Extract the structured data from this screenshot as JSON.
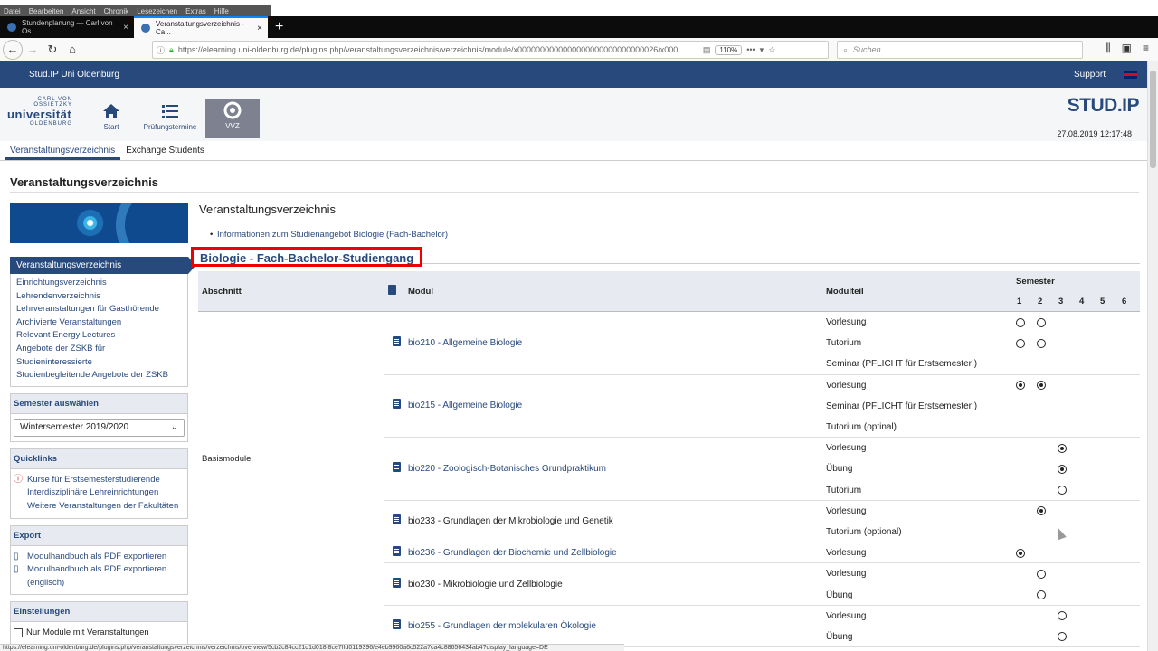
{
  "browser": {
    "menu": [
      "Datei",
      "Bearbeiten",
      "Ansicht",
      "Chronik",
      "Lesezeichen",
      "Extras",
      "Hilfe"
    ],
    "tabs": [
      {
        "title": "Stundenplanung — Carl von Os..."
      },
      {
        "title": "Veranstaltungsverzeichnis - Ca..."
      }
    ],
    "url": "https://elearning.uni-oldenburg.de/plugins.php/veranstaltungsverzeichnis/verzeichnis/module/x0000000000000000000000000000026/x000",
    "zoom": "110%",
    "search_placeholder": "Suchen",
    "status_url": "https://elearning.uni-oldenburg.de/plugins.php/veranstaltungsverzeichnis/verzeichnis/overview/5cb2c84cc21d1d018f8ce7ffd0119396/e4eb9960a6c522a7ca4c88656434ab4?display_language=DE"
  },
  "studip": {
    "site_name": "Stud.IP Uni Oldenburg",
    "support": "Support",
    "logo": {
      "line1": "CARL VON OSSIETZKY",
      "line2": "universität",
      "line3": "OLDENBURG"
    },
    "brand": "STUD.IP",
    "datetime": "27.08.2019 12:17:48",
    "nav": [
      {
        "label": "Start",
        "icon": "home-icon"
      },
      {
        "label": "Prüfungstermine",
        "icon": "list-icon"
      },
      {
        "label": "VVZ",
        "icon": "vvz-icon"
      }
    ],
    "subnav": [
      "Veranstaltungsverzeichnis",
      "Exchange Students"
    ]
  },
  "page": {
    "title": "Veranstaltungsverzeichnis"
  },
  "sidebar": {
    "active": "Veranstaltungsverzeichnis",
    "links": [
      "Einrichtungsverzeichnis",
      "Lehrendenverzeichnis",
      "Lehrveranstaltungen für Gasthörende",
      "Archivierte Veranstaltungen",
      "Relevant Energy Lectures",
      "Angebote der ZSKB für Studieninteressierte",
      "Studienbegleitende Angebote der ZSKB"
    ],
    "semester_header": "Semester auswählen",
    "semester_value": "Wintersemester 2019/2020",
    "quicklinks_header": "Quicklinks",
    "quicklinks": "Kurse für Erstsemesterstudierende Interdisziplinäre Lehreinrichtungen Weitere Veranstaltungen der Fakultäten",
    "export_header": "Export",
    "export": [
      "Modulhandbuch als PDF exportieren",
      "Modulhandbuch als PDF exportieren (englisch)"
    ],
    "settings_header": "Einstellungen",
    "settings_option": "Nur Module mit Veranstaltungen"
  },
  "main": {
    "heading": "Veranstaltungsverzeichnis",
    "info_link": "Informationen zum Studienangebot Biologie (Fach-Bachelor)",
    "section_title": "Biologie - Fach-Bachelor-Studiengang",
    "table": {
      "headers": {
        "abschnitt": "Abschnitt",
        "modul": "Modul",
        "modulteil": "Modulteil",
        "semester": "Semester"
      },
      "semesters": [
        "1",
        "2",
        "3",
        "4",
        "5",
        "6"
      ],
      "abschnitt": "Basismodule",
      "modules": [
        {
          "label": "bio210 - Allgemeine Biologie",
          "link": true,
          "teile": [
            {
              "name": "Vorlesung",
              "sem": [
                [
                  1,
                  false
                ],
                [
                  2,
                  false
                ]
              ]
            },
            {
              "name": "Tutorium",
              "sem": [
                [
                  1,
                  false
                ],
                [
                  2,
                  false
                ]
              ]
            },
            {
              "name": "Seminar (PFLICHT für Erstsemester!)",
              "sem": []
            }
          ]
        },
        {
          "label": "bio215 - Allgemeine Biologie",
          "link": true,
          "teile": [
            {
              "name": "Vorlesung",
              "sem": [
                [
                  1,
                  true
                ],
                [
                  2,
                  true
                ]
              ]
            },
            {
              "name": "Seminar (PFLICHT für Erstsemester!)",
              "sem": []
            },
            {
              "name": "Tutorium (optinal)",
              "sem": []
            }
          ]
        },
        {
          "label": "bio220 - Zoologisch-Botanisches Grundpraktikum",
          "link": true,
          "teile": [
            {
              "name": "Vorlesung",
              "sem": [
                [
                  3,
                  true
                ]
              ]
            },
            {
              "name": "Übung",
              "sem": [
                [
                  3,
                  true
                ]
              ]
            },
            {
              "name": "Tutorium",
              "sem": [
                [
                  3,
                  false
                ]
              ]
            }
          ]
        },
        {
          "label": "bio233 - Grundlagen der Mikrobiologie und Genetik",
          "link": false,
          "teile": [
            {
              "name": "Vorlesung",
              "sem": [
                [
                  2,
                  true
                ]
              ]
            },
            {
              "name": "Tutorium (optional)",
              "sem": []
            }
          ]
        },
        {
          "label": "bio236 - Grundlagen der Biochemie und Zellbiologie",
          "link": true,
          "teile": [
            {
              "name": "Vorlesung",
              "sem": [
                [
                  1,
                  true
                ]
              ]
            }
          ]
        },
        {
          "label": "bio230 - Mikrobiologie und Zellbiologie",
          "link": false,
          "teile": [
            {
              "name": "Vorlesung",
              "sem": [
                [
                  2,
                  false
                ]
              ]
            },
            {
              "name": "Übung",
              "sem": [
                [
                  2,
                  false
                ]
              ]
            }
          ]
        },
        {
          "label": "bio255 - Grundlagen der molekularen Ökologie",
          "link": true,
          "teile": [
            {
              "name": "Vorlesung",
              "sem": [
                [
                  3,
                  false
                ]
              ]
            },
            {
              "name": "Übung",
              "sem": [
                [
                  3,
                  false
                ]
              ]
            }
          ]
        }
      ]
    }
  }
}
